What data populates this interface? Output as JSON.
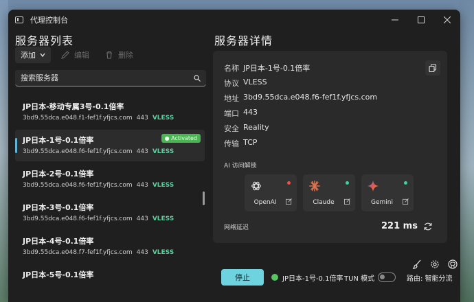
{
  "window": {
    "title": "代理控制台"
  },
  "left": {
    "title": "服务器列表",
    "toolbar": {
      "add": "添加",
      "edit": "编辑",
      "delete": "删除"
    },
    "search_placeholder": "搜索服务器",
    "items": [
      {
        "name": "JP日本-移动专属3号-0.1倍率",
        "address": "3bd9.55dca.e048.f1-fef1f.yfjcs.com",
        "port": "443",
        "protocol": "VLESS",
        "active": false
      },
      {
        "name": "JP日本-1号-0.1倍率",
        "address": "3bd9.55dca.e048.f6-fef1f.yfjcs.com",
        "port": "443",
        "protocol": "VLESS",
        "active": true,
        "badge": "● Activated"
      },
      {
        "name": "JP日本-2号-0.1倍率",
        "address": "3bd9.55dca.e048.f6-fef1f.yfjcs.com",
        "port": "443",
        "protocol": "VLESS",
        "active": false
      },
      {
        "name": "JP日本-3号-0.1倍率",
        "address": "3bd9.55dca.e048.f6-fef1f.yfjcs.com",
        "port": "443",
        "protocol": "VLESS",
        "active": false
      },
      {
        "name": "JP日本-4号-0.1倍率",
        "address": "3bd9.55dca.e048.f7-fef1f.yfjcs.com",
        "port": "443",
        "protocol": "VLESS",
        "active": false
      },
      {
        "name": "JP日本-5号-0.1倍率",
        "address": "",
        "port": "",
        "protocol": "",
        "active": false
      }
    ]
  },
  "details": {
    "title": "服务器详情",
    "rows": [
      {
        "key": "名称",
        "value": "JP日本-1号-0.1倍率"
      },
      {
        "key": "协议",
        "value": "VLESS"
      },
      {
        "key": "地址",
        "value": "3bd9.55dca.e048.f6-fef1f.yfjcs.com"
      },
      {
        "key": "端口",
        "value": "443"
      },
      {
        "key": "安全",
        "value": "Reality"
      },
      {
        "key": "传输",
        "value": "TCP"
      }
    ],
    "ai_label": "AI 访问解锁",
    "ai_services": [
      {
        "name": "OpenAI",
        "status_color": "#e5534b"
      },
      {
        "name": "Claude",
        "status_color": "#3fd0a0"
      },
      {
        "name": "Gemini",
        "status_color": "#3fd0a0"
      }
    ],
    "latency_label": "网络延迟",
    "latency_value": "221 ms"
  },
  "status_bar": {
    "stop_label": "停止",
    "connected_server": "JP日本-1号-0.1倍率",
    "tun_label": "TUN 模式",
    "route_label": "路由: 智能分流"
  },
  "colors": {
    "accent": "#6fd3df",
    "active_badge": "#4bb553",
    "protocol": "#5ed0a0"
  }
}
